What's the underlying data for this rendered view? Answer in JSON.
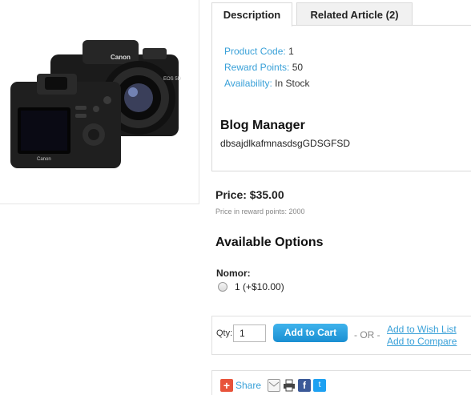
{
  "product_image": {
    "alt_brand_front": "Canon",
    "alt_brand_back": "Canon"
  },
  "tabs": [
    {
      "label": "Description",
      "active": true
    },
    {
      "label": "Related Article (2)",
      "active": false
    }
  ],
  "meta": {
    "product_code_label": "Product Code:",
    "product_code_value": "1",
    "reward_points_label": "Reward Points:",
    "reward_points_value": "50",
    "availability_label": "Availability:",
    "availability_value": "In Stock"
  },
  "description": {
    "title": "Blog Manager",
    "text": "dbsajdlkafmnasdsgGDSGFSD"
  },
  "price": {
    "label": "Price: $35.00",
    "reward_note": "Price in reward points: 2000"
  },
  "options": {
    "title": "Available Options",
    "group_label": "Nomor:",
    "choices": [
      {
        "label": "1 (+$10.00)",
        "selected": false
      }
    ]
  },
  "cart": {
    "qty_label": "Qty:",
    "qty_value": "1",
    "add_to_cart_label": "Add to Cart",
    "or_label": "- OR -",
    "wish_list_label": "Add to Wish List",
    "compare_label": "Add to Compare"
  },
  "share": {
    "share_label": "Share",
    "icons": [
      "plus-icon",
      "mail-icon",
      "print-icon",
      "facebook-icon",
      "twitter-icon"
    ]
  },
  "colors": {
    "link": "#38a0d8",
    "button": "#1a8fd2",
    "accent_share": "#e8533a"
  }
}
